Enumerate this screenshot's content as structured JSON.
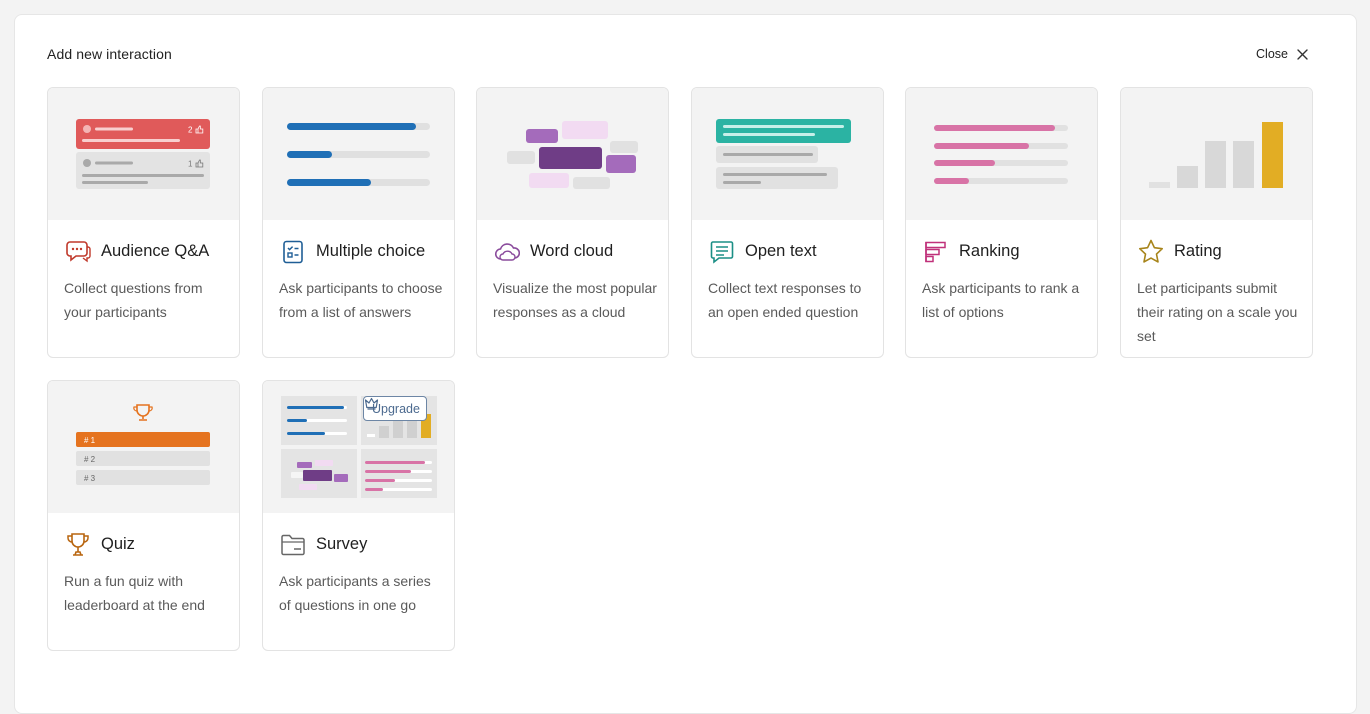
{
  "header": {
    "title": "Add new interaction",
    "close_label": "Close"
  },
  "cards": [
    {
      "title": "Audience Q&A",
      "description": "Collect questions from your participants",
      "icon": "chat-bubbles-icon",
      "preview": {
        "item1_count": "2",
        "item2_count": "1"
      }
    },
    {
      "title": "Multiple choice",
      "description": "Ask participants to choose from a list of answers",
      "icon": "checklist-icon"
    },
    {
      "title": "Word cloud",
      "description": "Visualize the most popular responses as a cloud",
      "icon": "cloud-icon"
    },
    {
      "title": "Open text",
      "description": "Collect text responses to an open ended question",
      "icon": "message-lines-icon"
    },
    {
      "title": "Ranking",
      "description": "Ask participants to rank a list of options",
      "icon": "ranking-bars-icon"
    },
    {
      "title": "Rating",
      "description": "Let participants submit their rating on a scale you set",
      "icon": "star-icon"
    },
    {
      "title": "Quiz",
      "description": "Run a fun quiz with leaderboard at the end",
      "icon": "trophy-icon",
      "preview": {
        "rank1": "# 1",
        "rank2": "# 2",
        "rank3": "# 3"
      }
    },
    {
      "title": "Survey",
      "description": "Ask participants a series of questions in one go",
      "icon": "folder-icon",
      "badge": "Upgrade"
    }
  ],
  "colors": {
    "qa_red": "#e05a5a",
    "blue": "#1f6fb6",
    "purple": "#7a4385",
    "teal": "#2bb3a3",
    "pink": "#d873a6",
    "gold": "#e2ad24",
    "orange": "#e5731f"
  }
}
